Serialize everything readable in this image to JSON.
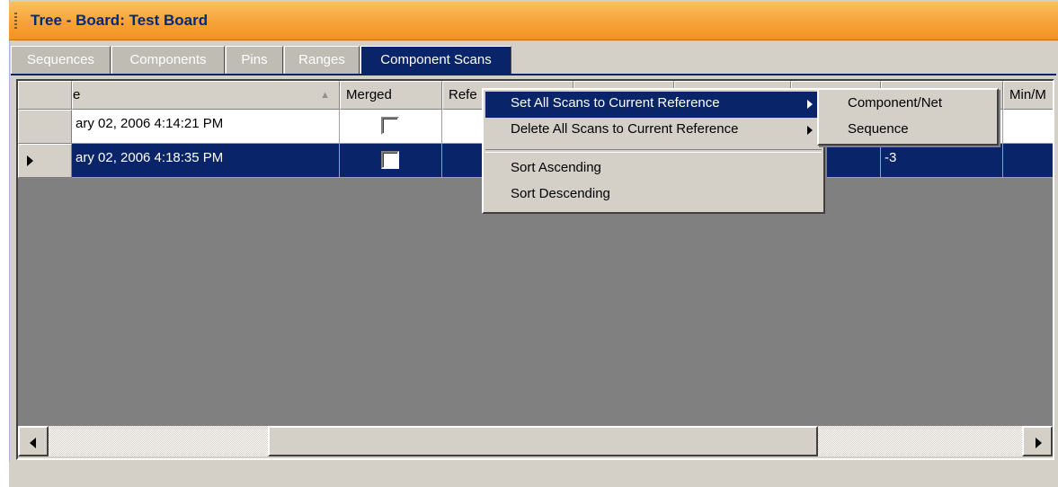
{
  "window": {
    "title": "Tree - Board: Test Board"
  },
  "tabs": [
    {
      "label": "Sequences",
      "active": false
    },
    {
      "label": "Components",
      "active": false
    },
    {
      "label": "Pins",
      "active": false
    },
    {
      "label": "Ranges",
      "active": false
    },
    {
      "label": "Component Scans",
      "active": true
    }
  ],
  "grid": {
    "columns": [
      {
        "label": "e",
        "sorted": "ascending"
      },
      {
        "label": "Merged"
      },
      {
        "label": "Refe"
      },
      {
        "label": ""
      },
      {
        "label": ""
      },
      {
        "label": ""
      },
      {
        "label": ""
      },
      {
        "label": "Min/M"
      }
    ],
    "rows": [
      {
        "date": "ary 02, 2006 4:14:21 PM",
        "merged": false,
        "value": "",
        "selected": false
      },
      {
        "date": "ary 02, 2006 4:18:35 PM",
        "merged": false,
        "value": "-3",
        "selected": true
      }
    ]
  },
  "context_menu": {
    "items": [
      {
        "label": "Set All Scans to Current Reference",
        "has_submenu": true,
        "highlighted": true
      },
      {
        "label": "Delete All Scans to Current Reference",
        "has_submenu": true,
        "highlighted": false
      },
      {
        "label": "Sort Ascending",
        "has_submenu": false
      },
      {
        "label": "Sort Descending",
        "has_submenu": false
      }
    ]
  },
  "submenu": {
    "items": [
      {
        "label": "Component/Net"
      },
      {
        "label": "Sequence"
      }
    ]
  },
  "colors": {
    "title_gradient_top": "#fdc05f",
    "title_gradient_bottom": "#f39224",
    "selection": "#0a246a",
    "grid_background": "#808080",
    "chrome": "#d4d0c8"
  }
}
